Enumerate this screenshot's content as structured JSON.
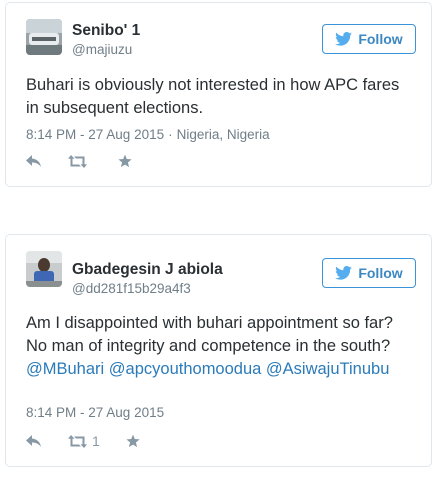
{
  "tweets": [
    {
      "name": "Senibo' 1",
      "handle": "@majiuzu",
      "follow_label": "Follow",
      "text": "Buhari is obviously not interested in how APC fares in subsequent elections.",
      "timestamp": "8:14 PM - 27 Aug 2015",
      "separator": "·",
      "location": "Nigeria, Nigeria",
      "retweet_count": ""
    },
    {
      "name": "Gbadegesin J abiola",
      "handle": "@dd281f15b29a4f3",
      "follow_label": "Follow",
      "text": "Am I disappointed with buhari appointment so far? No man of integrity and competence in the south?",
      "mentions": [
        "@MBuhari",
        "@apcyouthomoodua",
        "@AsiwajuTinubu"
      ],
      "timestamp": "8:14 PM - 27 Aug 2015",
      "retweet_count": "1"
    }
  ],
  "icons": [
    "twitter-bird-icon",
    "reply-icon",
    "retweet-icon",
    "favorite-star-icon"
  ],
  "colors": {
    "accent": "#3b88c3",
    "link": "#2b7bb9",
    "muted": "#707e88",
    "border": "#e1e8ed"
  }
}
